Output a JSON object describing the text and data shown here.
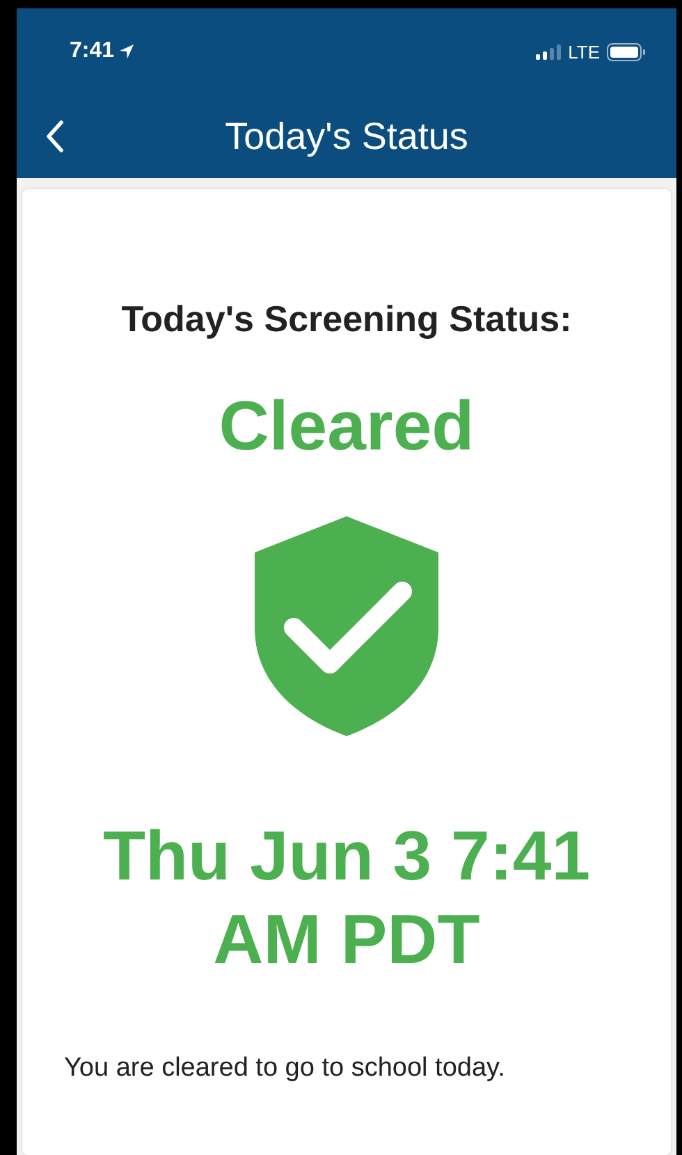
{
  "status_bar": {
    "time": "7:41",
    "network": "LTE"
  },
  "nav": {
    "title": "Today's Status"
  },
  "screening": {
    "heading": "Today's Screening Status:",
    "status": "Cleared",
    "kind": "cleared",
    "timestamp": "Thu Jun 3 7:41 AM PDT",
    "message": "You are cleared to go to school today."
  }
}
